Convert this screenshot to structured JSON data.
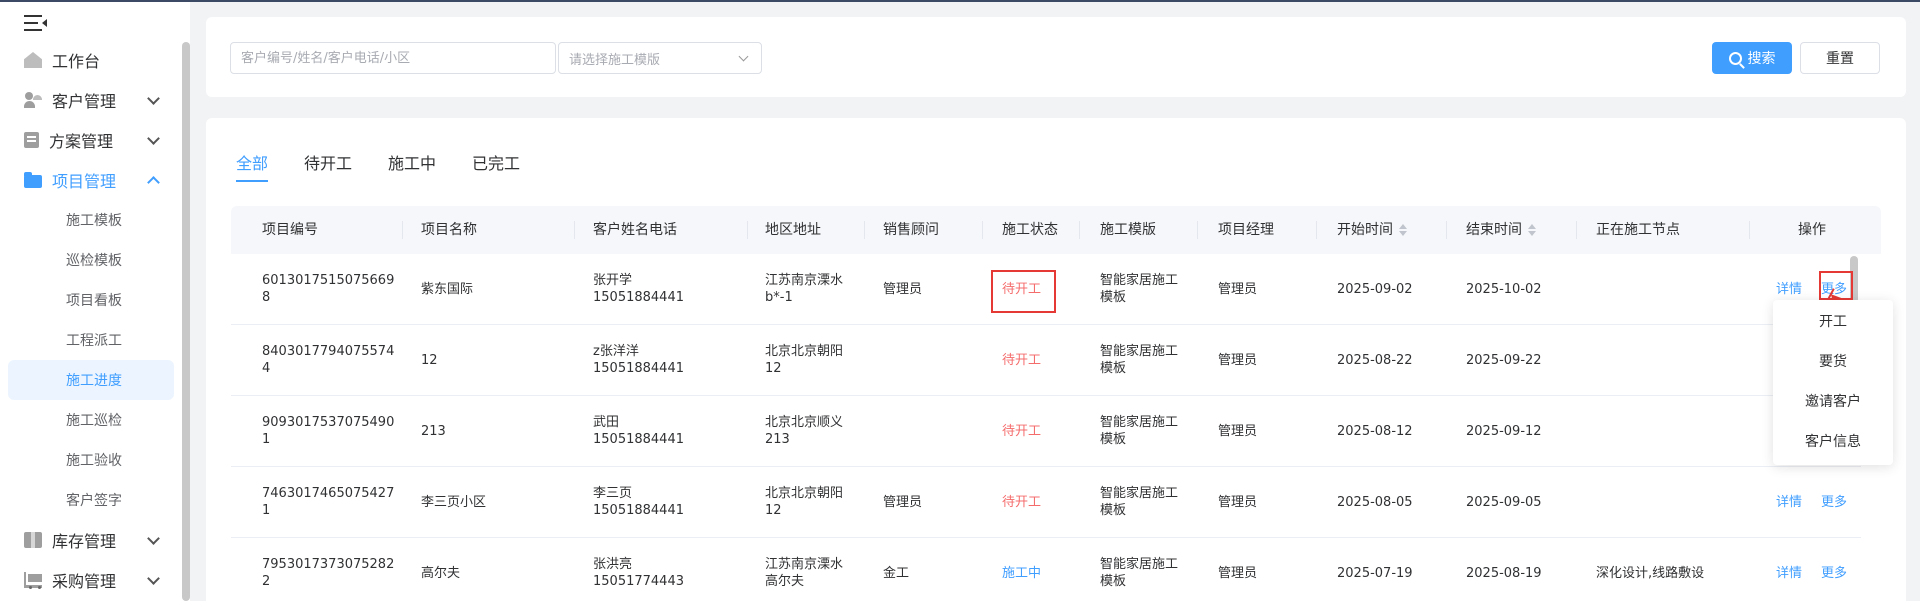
{
  "sidebar": {
    "menu": [
      {
        "label": "工作台",
        "icon": "house-icon"
      },
      {
        "label": "客户管理",
        "icon": "user-icon"
      },
      {
        "label": "方案管理",
        "icon": "document-icon"
      },
      {
        "label": "项目管理",
        "icon": "folder-icon"
      },
      {
        "label": "库存管理",
        "icon": "box-icon"
      },
      {
        "label": "采购管理",
        "icon": "cart-icon"
      }
    ],
    "sub_items": [
      "施工模板",
      "巡检模板",
      "项目看板",
      "工程派工",
      "施工进度",
      "施工巡检",
      "施工验收",
      "客户签字"
    ],
    "active_sub": "施工进度"
  },
  "search": {
    "keyword_placeholder": "客户编号/姓名/客户电话/小区",
    "template_placeholder": "请选择施工模版",
    "search_label": "搜索",
    "reset_label": "重置"
  },
  "tabs": [
    "全部",
    "待开工",
    "施工中",
    "已完工"
  ],
  "table": {
    "headers": [
      "项目编号",
      "项目名称",
      "客户姓名电话",
      "地区地址",
      "销售顾问",
      "施工状态",
      "施工模版",
      "项目经理",
      "开始时间",
      "结束时间",
      "正在施工节点",
      "操作"
    ],
    "rows": [
      {
        "id_1": "6013017515075669",
        "id_2": "8",
        "name": "紫东国际",
        "customer": "张开学",
        "phone": "15051884441",
        "addr_1": "江苏南京溧水",
        "addr_2": "b*-1",
        "sales": "管理员",
        "status": "待开工",
        "tpl_1": "智能家居施工",
        "tpl_2": "模板",
        "manager": "管理员",
        "start": "2025-09-02",
        "end": "2025-10-02",
        "node": "",
        "detail": "详情",
        "more": "更多"
      },
      {
        "id_1": "8403017794075574",
        "id_2": "4",
        "name": "12",
        "customer": "z张洋洋",
        "phone": "15051884441",
        "addr_1": "北京北京朝阳",
        "addr_2": "12",
        "sales": "",
        "status": "待开工",
        "tpl_1": "智能家居施工",
        "tpl_2": "模板",
        "manager": "管理员",
        "start": "2025-08-22",
        "end": "2025-09-22",
        "node": "",
        "detail": "",
        "more": ""
      },
      {
        "id_1": "9093017537075490",
        "id_2": "1",
        "name": "213",
        "customer": "武田",
        "phone": "15051884441",
        "addr_1": "北京北京顺义",
        "addr_2": "213",
        "sales": "",
        "status": "待开工",
        "tpl_1": "智能家居施工",
        "tpl_2": "模板",
        "manager": "管理员",
        "start": "2025-08-12",
        "end": "2025-09-12",
        "node": "",
        "detail": "",
        "more": ""
      },
      {
        "id_1": "7463017465075427",
        "id_2": "1",
        "name": "李三页小区",
        "customer": "李三页",
        "phone": "15051884441",
        "addr_1": "北京北京朝阳",
        "addr_2": "12",
        "sales": "管理员",
        "status": "待开工",
        "tpl_1": "智能家居施工",
        "tpl_2": "模板",
        "manager": "管理员",
        "start": "2025-08-05",
        "end": "2025-09-05",
        "node": "",
        "detail": "详情",
        "more": "更多"
      },
      {
        "id_1": "7953017373075282",
        "id_2": "2",
        "name": "高尔夫",
        "customer": "张洪亮",
        "phone": "15051774443",
        "addr_1": "江苏南京溧水",
        "addr_2": "高尔夫",
        "sales": "金工",
        "status": "施工中",
        "tpl_1": "智能家居施工",
        "tpl_2": "模板",
        "manager": "管理员",
        "start": "2025-07-19",
        "end": "2025-08-19",
        "node": "深化设计,线路敷设",
        "detail": "详情",
        "more": "更多"
      }
    ]
  },
  "more_menu": [
    "开工",
    "要货",
    "邀请客户",
    "客户信息"
  ],
  "colors": {
    "primary": "#409eff",
    "danger": "#f56c6c",
    "annotation": "#e53935"
  }
}
